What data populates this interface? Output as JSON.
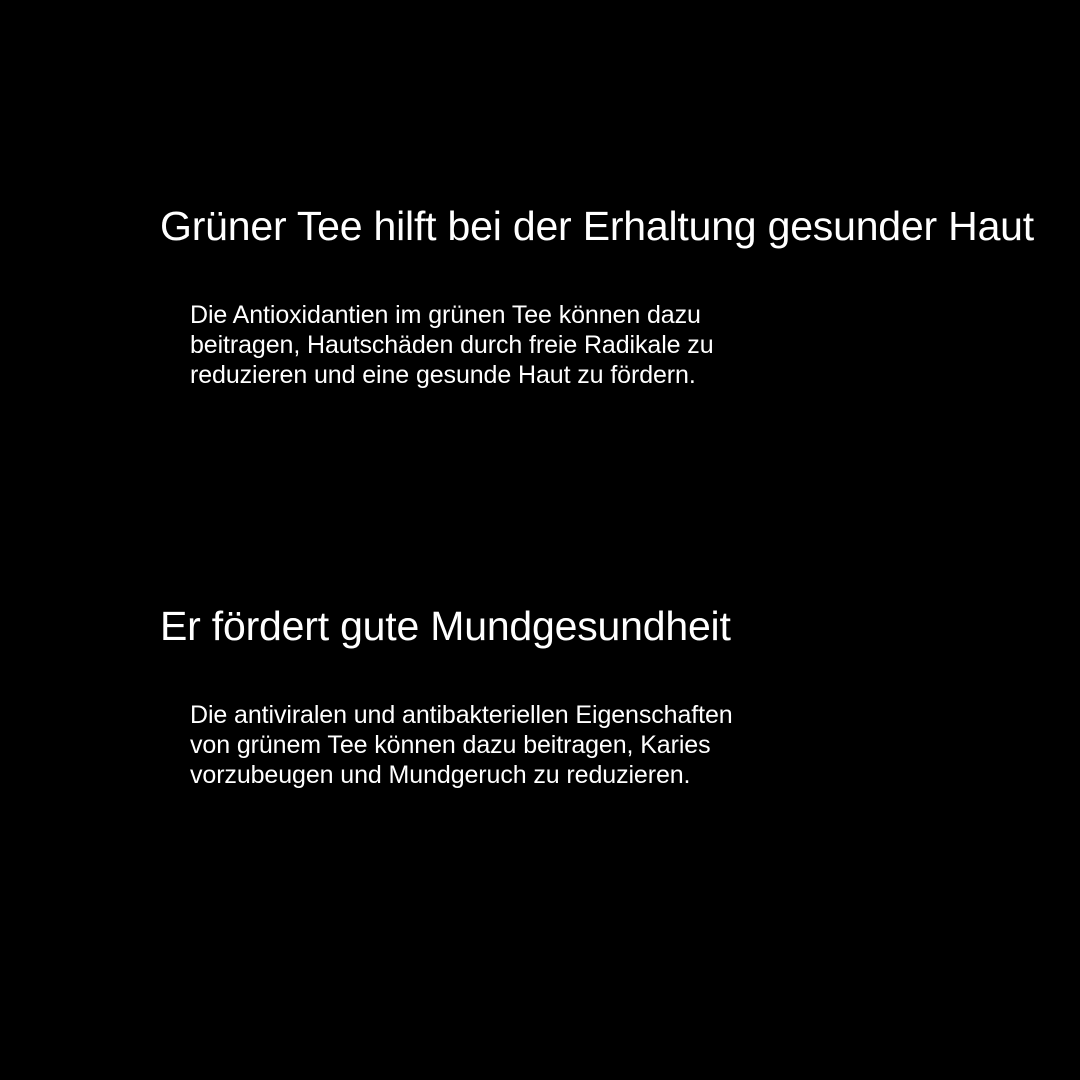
{
  "background_color": "#000000",
  "text_color": "#ffffff",
  "sections": [
    {
      "heading": "Grüner Tee hilft bei der Erhaltung gesunder Haut",
      "lines": [
        "Die Antioxidantien im grünen Tee können dazu",
        "beitragen, Hautschäden durch freie Radikale zu",
        "reduzieren und eine gesunde Haut zu fördern."
      ]
    },
    {
      "heading": "Er fördert gute Mundgesundheit",
      "lines": [
        "Die antiviralen und antibakteriellen Eigenschaften",
        "von grünem Tee können dazu beitragen, Karies",
        "vorzubeugen und Mundgeruch zu reduzieren."
      ]
    }
  ]
}
